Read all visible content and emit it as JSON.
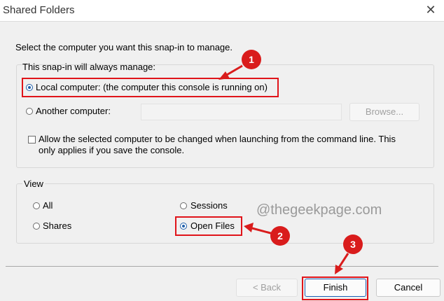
{
  "window": {
    "title": "Shared Folders",
    "close_glyph": "✕"
  },
  "instruction": "Select the computer you want this snap-in to manage.",
  "manage_group": {
    "caption": "This snap-in will always manage:",
    "local_label": "Local computer:  (the computer this console is running on)",
    "local_selected": true,
    "another_label": "Another computer:",
    "another_value": "",
    "browse_label": "Browse...",
    "allow_change_line1": "Allow the selected computer to be changed when launching from the command line.  This",
    "allow_change_line2": "only applies if you save the console.",
    "allow_change_checked": false
  },
  "view_group": {
    "caption": "View",
    "options": [
      "All",
      "Sessions",
      "Shares",
      "Open Files"
    ],
    "selected": "Open Files"
  },
  "buttons": {
    "back": "< Back",
    "finish": "Finish",
    "cancel": "Cancel"
  },
  "annotations": {
    "markers": [
      "1",
      "2",
      "3"
    ],
    "marker_color": "#d91c1c",
    "watermark": "@thegeekpage.com"
  },
  "colors": {
    "accent": "#1f5faa",
    "highlight": "#e0141a"
  }
}
